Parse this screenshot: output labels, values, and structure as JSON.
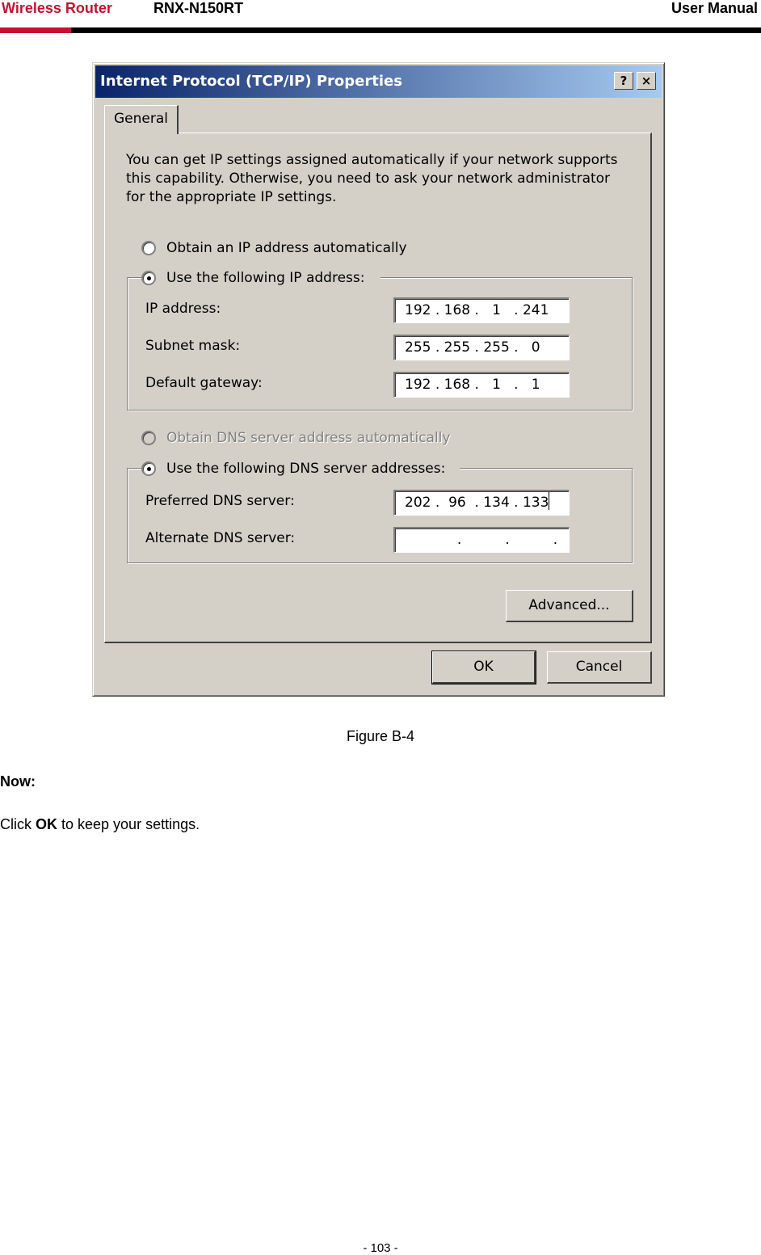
{
  "header": {
    "brand": "Wireless Router",
    "model": "RNX-N150RT",
    "doc_type": "User Manual"
  },
  "dialog": {
    "title": "Internet Protocol (TCP/IP) Properties",
    "help_label": "?",
    "close_label": "×",
    "tab_general": "General",
    "description": "You can get IP settings assigned automatically if your network supports this capability. Otherwise, you need to ask your network administrator for the appropriate IP settings.",
    "radio_obtain_ip": "Obtain an IP address automatically",
    "radio_use_ip": "Use the following IP address:",
    "ip_label": "IP address:",
    "ip_value": "192 . 168 .   1   . 241",
    "subnet_label": "Subnet mask:",
    "subnet_value": "255 . 255 . 255 .   0",
    "gateway_label": "Default gateway:",
    "gateway_value": "192 . 168 .   1   .   1",
    "radio_obtain_dns": "Obtain DNS server address automatically",
    "radio_use_dns": "Use the following DNS server addresses:",
    "pref_dns_label": "Preferred DNS server:",
    "pref_dns_value": "202 .  96  . 134 . 133",
    "alt_dns_label": "Alternate DNS server:",
    "alt_dns_value": "            .          .          .",
    "advanced_label": "Advanced...",
    "ok_label": "OK",
    "cancel_label": "Cancel"
  },
  "caption": "Figure B-4",
  "now_heading": "Now:",
  "instruction": {
    "prefix": "Click ",
    "bold": "OK",
    "suffix": " to keep your settings."
  },
  "page_number": "- 103 -",
  "colors": {
    "brand_red": "#c8102e",
    "title_start": "#0a246a",
    "title_end": "#a6caf0",
    "dialog_face": "#d4d0c8"
  }
}
